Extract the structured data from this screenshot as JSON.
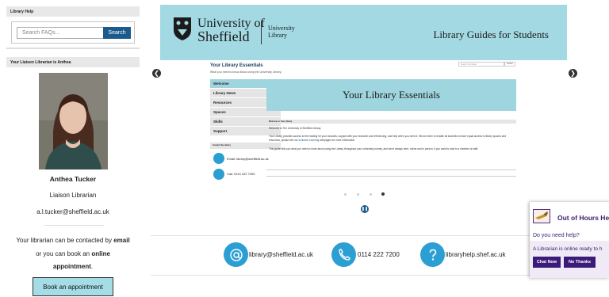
{
  "sidebar": {
    "library_help_title": "Library Help",
    "search": {
      "placeholder": "Search FAQs...",
      "button": "Search"
    },
    "liaison_title": "Your Liaison Librarian is Anthea",
    "librarian": {
      "name": "Anthea Tucker",
      "role": "Liaison Librarian",
      "email": "a.l.tucker@sheffield.ac.uk"
    },
    "contact_line1_pre": "Your librarian can be contacted by ",
    "contact_line1_bold": "email",
    "contact_line2_pre": "or you can book an ",
    "contact_line2_bold": "online",
    "contact_line3_bold": "appointment",
    "contact_line3_post": ".",
    "book_button": "Book an appointment"
  },
  "carousel": {
    "banner": {
      "uni_line1": "University of",
      "uni_line2": "Sheffield",
      "lib_line1": "University",
      "lib_line2": "Library",
      "title": "Library Guides for Students"
    },
    "prev_icon": "chevron-left-icon",
    "next_icon": "chevron-right-icon",
    "slide": {
      "title": "Your Library Essentials",
      "subtitle": "What you need to know about using the University Library.",
      "search_placeholder": "Search this Guide",
      "search_button": "Search",
      "menu": [
        "Welcome",
        "Library News",
        "Resources",
        "Spaces",
        "Skills",
        "Support"
      ],
      "contact_heading": "Contact the Library",
      "contact_email": "Email: library@sheffield.ac.uk",
      "contact_phone": "Call: 0114 222 7200",
      "banner_text": "Your Library Essentials",
      "welcome_bar": "Welcome to Your Library",
      "p1": "Welcome to The University of Sheffield Library.",
      "p2": "Your Library provides access to the reading for your modules, support with your research and referencing, and help when you need it. We are keen to enable all students to have equal access to library spaces and resources, please see our",
      "p2_link": "Inclusive Learning",
      "p2_post": "webpages for more information.",
      "p3": "This guide tells you what you need to know about using the Library throughout your university journey, and we're always here, online and in person, if you want to chat to a member of staff."
    },
    "dots": 4,
    "active_dot": 4,
    "pause_icon": "pause-icon"
  },
  "contacts": [
    {
      "icon": "at-sign-icon",
      "text": "library@sheffield.ac.uk"
    },
    {
      "icon": "phone-icon",
      "text": "0114 222 7200"
    },
    {
      "icon": "question-mark-icon",
      "text": "libraryhelp.shef.ac.uk"
    }
  ],
  "chat": {
    "title": "Out of Hours He",
    "question": "Do you need help?",
    "message": "A Librarian is online ready to h",
    "chat_button": "Chat Now",
    "no_button": "No Thanks"
  },
  "colors": {
    "banner": "#a3d9e3",
    "search_button": "#1a5a8c",
    "contact_circle": "#2b9fd3",
    "chat_purple": "#3b1a7a"
  }
}
